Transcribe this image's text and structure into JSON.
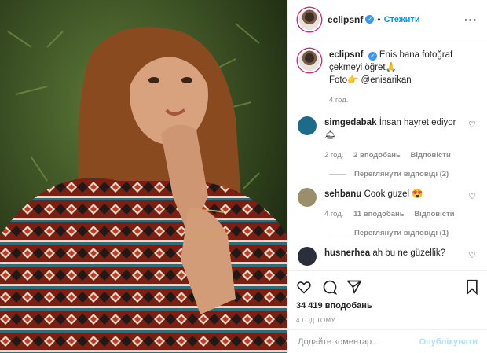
{
  "post": {
    "username": "eclipsnf",
    "follow_label": "Стежити",
    "caption": "Enis bana fotoğraf çekmeyi öğret🙏",
    "caption_line2": "Foto👉 @enisarikan",
    "caption_time": "4 год.",
    "likes": "34 419 вподобань",
    "date": "4 ГОД ТОМУ",
    "comment_placeholder": "Додайте коментар...",
    "publish_label": "Опублікувати"
  },
  "comments": [
    {
      "user": "simgedabak",
      "text": "İnsan hayret ediyor 🛎",
      "time": "2 год.",
      "likes": "2 вподобань",
      "reply": "Відповісти",
      "view_replies": "Переглянути відповіді (2)",
      "avatar_color": "#1d6b8a"
    },
    {
      "user": "sehbanu",
      "text": "Cook guzel 😍",
      "time": "4 год.",
      "likes": "11 вподобань",
      "reply": "Відповісти",
      "view_replies": "Переглянути відповіді (1)",
      "avatar_color": "#9a8f6a"
    },
    {
      "user": "husnerhea",
      "text": "ah bu ne güzellik?",
      "avatar_color": "#2a2f3b"
    }
  ],
  "colors": {
    "accent": "#0095f6",
    "muted": "#8e8e8e",
    "border": "#efefef"
  }
}
